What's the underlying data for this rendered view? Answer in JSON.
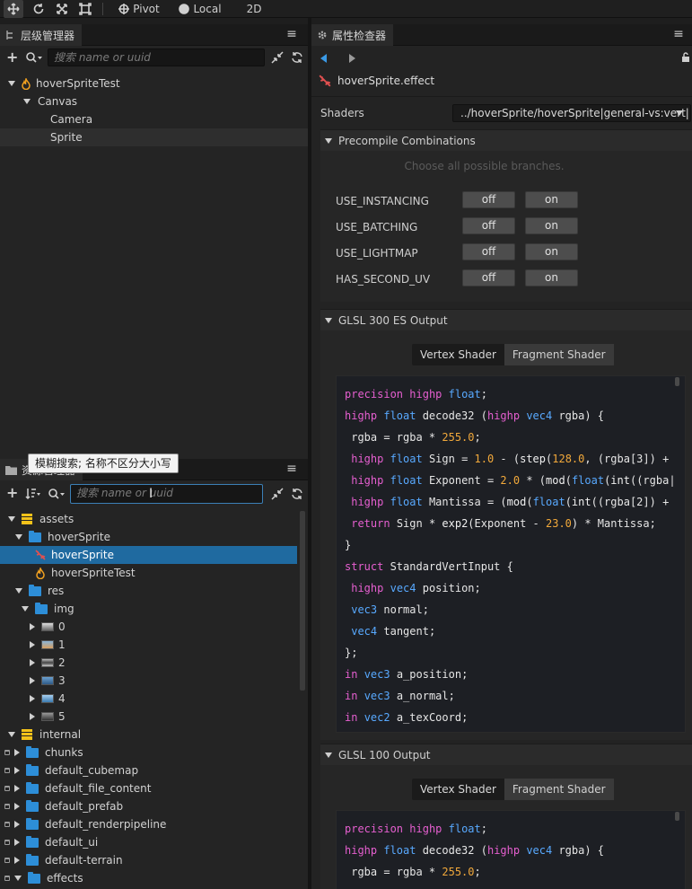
{
  "toolbar": {
    "pivot_label": "Pivot",
    "local_label": "Local",
    "mode_2d_label": "2D"
  },
  "hierarchy": {
    "tab_label": "层级管理器",
    "search_placeholder": "搜索 name or uuid",
    "nodes": [
      {
        "label": "hoverSpriteTest",
        "depth": 0
      },
      {
        "label": "Canvas",
        "depth": 1
      },
      {
        "label": "Camera",
        "depth": 2
      },
      {
        "label": "Sprite",
        "depth": 2
      }
    ]
  },
  "assets": {
    "tab_label": "资源管理器",
    "tooltip": "模糊搜索; 名称不区分大小写",
    "search_placeholder": "搜索 name or uuid",
    "items": [
      {
        "label": "assets"
      },
      {
        "label": "hoverSprite"
      },
      {
        "label": "hoverSprite"
      },
      {
        "label": "hoverSpriteTest"
      },
      {
        "label": "res"
      },
      {
        "label": "img"
      },
      {
        "label": "0"
      },
      {
        "label": "1"
      },
      {
        "label": "2"
      },
      {
        "label": "3"
      },
      {
        "label": "4"
      },
      {
        "label": "5"
      },
      {
        "label": "internal"
      },
      {
        "label": "chunks"
      },
      {
        "label": "default_cubemap"
      },
      {
        "label": "default_file_content"
      },
      {
        "label": "default_prefab"
      },
      {
        "label": "default_renderpipeline"
      },
      {
        "label": "default_ui"
      },
      {
        "label": "default-terrain"
      },
      {
        "label": "effects"
      }
    ]
  },
  "inspector": {
    "tab_label": "属性检查器",
    "asset_title": "hoverSprite.effect",
    "shaders_label": "Shaders",
    "shaders_value": "../hoverSprite/hoverSprite|general-vs:vert|...",
    "precompile_title": "Precompile Combinations",
    "precompile_hint": "Choose all possible branches.",
    "macros": [
      {
        "name": "USE_INSTANCING",
        "off": "off",
        "on": "on"
      },
      {
        "name": "USE_BATCHING",
        "off": "off",
        "on": "on"
      },
      {
        "name": "USE_LIGHTMAP",
        "off": "off",
        "on": "on"
      },
      {
        "name": "HAS_SECOND_UV",
        "off": "off",
        "on": "on"
      }
    ],
    "glsl300_title": "GLSL 300 ES Output",
    "glsl100_title": "GLSL 100 Output",
    "vertex_tab": "Vertex Shader",
    "fragment_tab": "Fragment Shader",
    "code300": [
      "precision highp float;",
      "highp float decode32 (highp vec4 rgba) {",
      " rgba = rgba * 255.0;",
      " highp float Sign = 1.0 - (step(128.0, (rgba[3]) + ",
      " highp float Exponent = 2.0 * (mod(float(int((rgba|",
      " highp float Mantissa = (mod(float(int((rgba[2]) + ",
      " return Sign * exp2(Exponent - 23.0) * Mantissa;",
      "}",
      "struct StandardVertInput {",
      " highp vec4 position;",
      " vec3 normal;",
      " vec4 tangent;",
      "};",
      "in vec3 a_position;",
      "in vec3 a_normal;",
      "in vec2 a_texCoord;"
    ],
    "code100": [
      "precision highp float;",
      "highp float decode32 (highp vec4 rgba) {",
      " rgba = rgba * 255.0;"
    ]
  },
  "colors": {
    "selection": "#1f6aa0",
    "keyword": "#e65fd0",
    "type": "#58a9ff",
    "number": "#f2a93b",
    "folder": "#2d8ed8"
  }
}
